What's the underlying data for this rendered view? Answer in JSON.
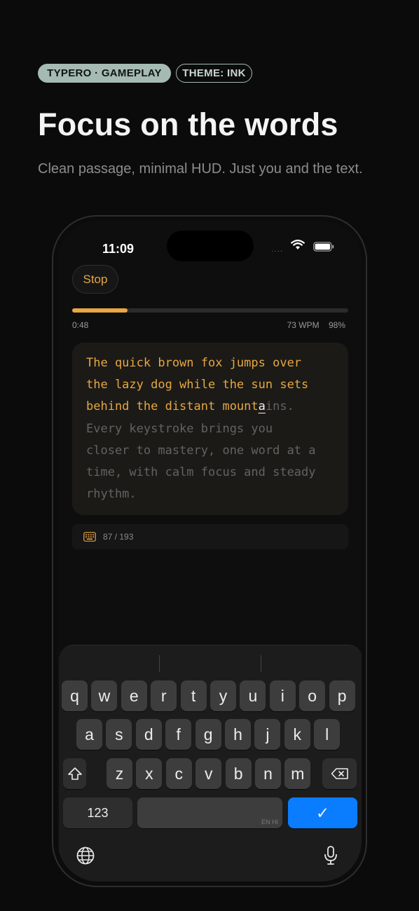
{
  "header": {
    "badge_primary": "TYPERO · GAMEPLAY",
    "badge_theme": "THEME: INK",
    "title": "Focus on the words",
    "subtitle": "Clean passage, minimal HUD. Just you and the text."
  },
  "status_bar": {
    "time": "11:09",
    "signal": "····"
  },
  "game": {
    "stop_label": "Stop",
    "progress_percent": 20,
    "elapsed": "0:48",
    "wpm": "73 WPM",
    "accuracy": "98%",
    "passage_typed": "The quick brown fox jumps over\nthe lazy dog while the sun sets\nbehind the distant mount",
    "passage_cursor": "a",
    "passage_remaining": "ins.\nEvery keystroke brings you\ncloser to mastery, one word at a\ntime, with calm focus and steady\nrhythm.",
    "char_count": "87 / 193"
  },
  "keyboard": {
    "row1": [
      "q",
      "w",
      "e",
      "r",
      "t",
      "y",
      "u",
      "i",
      "o",
      "p"
    ],
    "row2": [
      "a",
      "s",
      "d",
      "f",
      "g",
      "h",
      "j",
      "k",
      "l"
    ],
    "row3": [
      "z",
      "x",
      "c",
      "v",
      "b",
      "n",
      "m"
    ],
    "numbers_label": "123",
    "space_hint": "EN HI",
    "return_label": "✓"
  },
  "colors": {
    "accent": "#e8a741",
    "badge": "#a6bab4",
    "return_key": "#0a7dff"
  }
}
